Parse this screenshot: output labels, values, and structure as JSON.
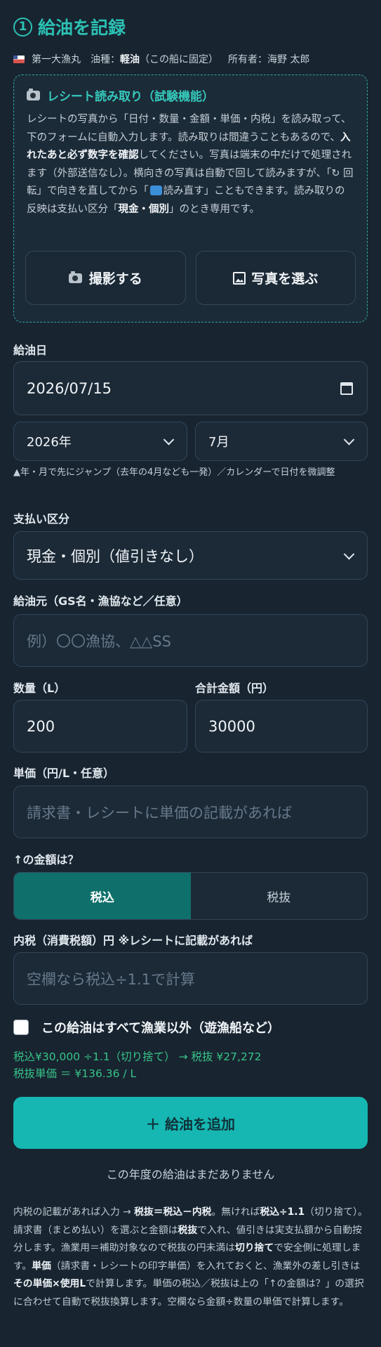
{
  "header": {
    "step_number": "1",
    "title": "給油を記録"
  },
  "boat": {
    "name": "第一大漁丸",
    "fuel_label": "油種：",
    "fuel_type": "軽油",
    "fuel_note": "（この船に固定）",
    "owner_label": "所有者：",
    "owner": "海野 太郎"
  },
  "receipt": {
    "title": "レシート読み取り（試験機能）",
    "desc_1": "レシートの写真から「日付・数量・金額・単価・内税」を読み取って、下のフォームに自動入力します。読み取りは間違うこともあるので、",
    "desc_bold_1": "入れたあと必ず数字を確認",
    "desc_2": "してください。写真は端末の中だけで処理されます（外部送信なし）。横向きの写真は自動で回して読みますが、「↻ 回転」で向きを直してから「",
    "desc_reread": "読み直す",
    "desc_3": "」こともできます。読み取りの反映は支払い区分「",
    "desc_bold_2": "現金・個別",
    "desc_4": "」のとき専用です。",
    "capture_button": "撮影する",
    "choose_button": "写真を選ぶ"
  },
  "form": {
    "date_label": "給油日",
    "date_value": "2026/07/15",
    "year_select": "2026年",
    "month_select": "7月",
    "jump_hint": "▲年・月で先にジャンプ（去年の4月なども一発）／カレンダーで日付を微調整",
    "payment_label": "支払い区分",
    "payment_value": "現金・個別（値引きなし）",
    "source_label": "給油元（GS名・漁協など／任意）",
    "source_placeholder": "例）〇〇漁協、△△SS",
    "quantity_label": "数量（L）",
    "quantity_value": "200",
    "total_label": "合計金額（円）",
    "total_value": "30000",
    "unit_price_label": "単価（円/L・任意）",
    "unit_price_placeholder": "請求書・レシートに単価の記載があれば",
    "amount_question": "↑の金額は？",
    "tax_incl": "税込",
    "tax_excl": "税抜",
    "inner_tax_label": "内税（消費税額）円 ※レシートに記載があれば",
    "inner_tax_placeholder": "空欄なら税込÷1.1で計算",
    "non_fishing_label": "この給油はすべて漁業以外（遊漁船など）",
    "calc_line_1": "税込¥30,000 ÷1.1（切り捨て） → 税抜 ¥27,272",
    "calc_line_2": "税抜単価 ＝ ¥136.36 / L",
    "add_button": "＋ 給油を追加"
  },
  "empty_message": "この年度の給油はまだありません",
  "footer": {
    "p1": "内税の記載があれば入力 → ",
    "b1": "税抜＝税込－内税",
    "p2": "。無ければ",
    "b2": "税込÷1.1",
    "p3": "（切り捨て）。請求書（まとめ払い）を選ぶと金額は",
    "b3": "税抜",
    "p4": "で入れ、値引きは実支払額から自動按分します。漁業用＝補助対象なので税抜の円未満は",
    "b4": "切り捨て",
    "p5": "で安全側に処理します。",
    "b5": "単価",
    "p6": "（請求書・レシートの印字単価）を入れておくと、漁業外の差し引きは",
    "b6": "その単価×使用L",
    "p7": "で計算します。単価の税込／税抜は上の「↑の金額は？」の選択に合わせて自動で税抜換算します。空欄なら金額÷数量の単価で計算します。"
  },
  "colors": {
    "accent": "#2cc1b4",
    "button": "#16b7b2",
    "background": "#182430",
    "calc_green": "#37c489"
  }
}
